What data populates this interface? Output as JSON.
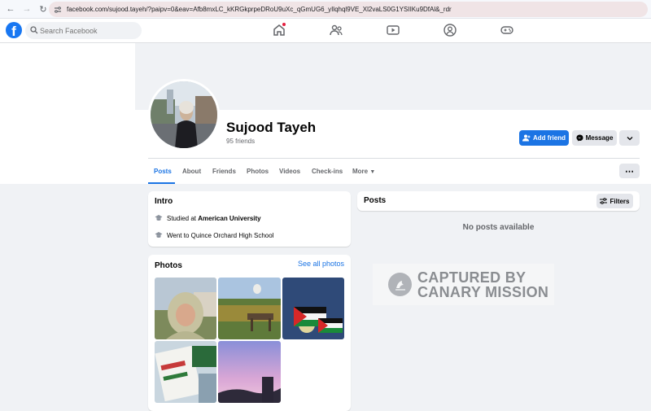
{
  "browser": {
    "url": "facebook.com/sujood.tayeh/?paipv=0&eav=Afb8mxLC_kKRGkprpeDRoU9uXc_qGmUG6_yIlqhql9VE_Xl2vaLS0G1YSIIKu9DfAl&_rdr"
  },
  "header": {
    "logo": "f",
    "search_placeholder": "Search Facebook"
  },
  "profile": {
    "name": "Sujood Tayeh",
    "friends": "95 friends",
    "add_friend": "Add friend",
    "message": "Message"
  },
  "tabs": [
    {
      "label": "Posts"
    },
    {
      "label": "About"
    },
    {
      "label": "Friends"
    },
    {
      "label": "Photos"
    },
    {
      "label": "Videos"
    },
    {
      "label": "Check-ins"
    },
    {
      "label": "More"
    }
  ],
  "intro": {
    "title": "Intro",
    "studied_prefix": "Studied at ",
    "studied_school": "American University",
    "went_to": "Went to Quince Orchard High School"
  },
  "photos": {
    "title": "Photos",
    "see_all": "See all photos"
  },
  "posts": {
    "title": "Posts",
    "filters": "Filters",
    "empty": "No posts available"
  },
  "watermark": {
    "line1": "CAPTURED BY",
    "line2": "CANARY MISSION"
  },
  "colors": {
    "brand": "#1877f2",
    "accent": "#1b74e4",
    "notification": "#e41e3f"
  }
}
